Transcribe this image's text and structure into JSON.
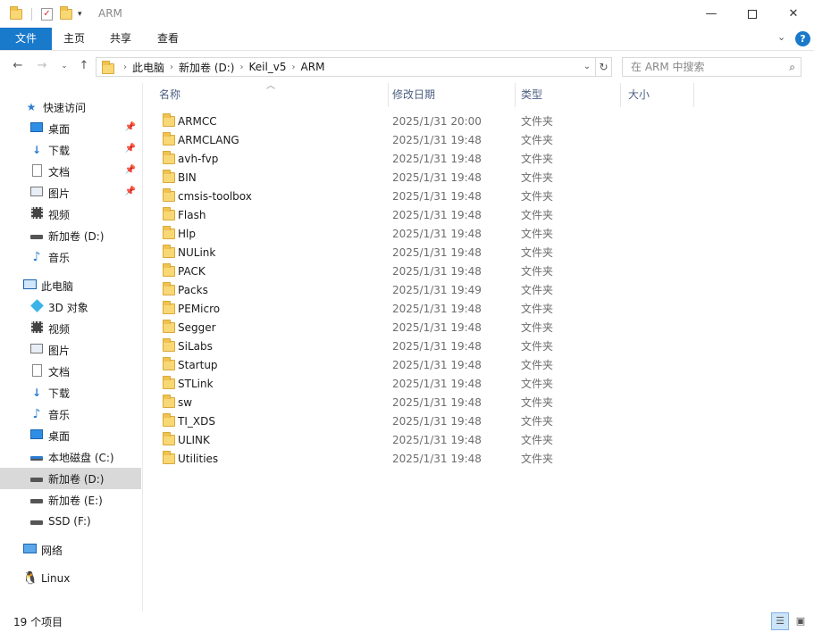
{
  "window": {
    "title": "ARM",
    "minimize_icon": "minimize-icon",
    "maximize_icon": "maximize-icon",
    "close_icon": "close-icon"
  },
  "ribbon": {
    "tabs": [
      "文件",
      "主页",
      "共享",
      "查看"
    ],
    "accent": "#1979ca"
  },
  "address": {
    "crumbs": [
      "此电脑",
      "新加卷 (D:)",
      "Keil_v5",
      "ARM"
    ],
    "search_placeholder": "在 ARM 中搜索"
  },
  "nav": {
    "quick_access": "快速访问",
    "quick_items": [
      "桌面",
      "下载",
      "文档",
      "图片",
      "视频",
      "新加卷 (D:)",
      "音乐"
    ],
    "this_pc": "此电脑",
    "pc_items": [
      "3D 对象",
      "视频",
      "图片",
      "文档",
      "下载",
      "音乐",
      "桌面",
      "本地磁盘 (C:)",
      "新加卷 (D:)",
      "新加卷 (E:)",
      "SSD (F:)"
    ],
    "network": "网络",
    "linux": "Linux"
  },
  "columns": {
    "name": "名称",
    "date": "修改日期",
    "type": "类型",
    "size": "大小"
  },
  "files": [
    {
      "name": "ARMCC",
      "date": "2025/1/31 20:00",
      "type": "文件夹"
    },
    {
      "name": "ARMCLANG",
      "date": "2025/1/31 19:48",
      "type": "文件夹"
    },
    {
      "name": "avh-fvp",
      "date": "2025/1/31 19:48",
      "type": "文件夹"
    },
    {
      "name": "BIN",
      "date": "2025/1/31 19:48",
      "type": "文件夹"
    },
    {
      "name": "cmsis-toolbox",
      "date": "2025/1/31 19:48",
      "type": "文件夹"
    },
    {
      "name": "Flash",
      "date": "2025/1/31 19:48",
      "type": "文件夹"
    },
    {
      "name": "Hlp",
      "date": "2025/1/31 19:48",
      "type": "文件夹"
    },
    {
      "name": "NULink",
      "date": "2025/1/31 19:48",
      "type": "文件夹"
    },
    {
      "name": "PACK",
      "date": "2025/1/31 19:48",
      "type": "文件夹"
    },
    {
      "name": "Packs",
      "date": "2025/1/31 19:49",
      "type": "文件夹"
    },
    {
      "name": "PEMicro",
      "date": "2025/1/31 19:48",
      "type": "文件夹"
    },
    {
      "name": "Segger",
      "date": "2025/1/31 19:48",
      "type": "文件夹"
    },
    {
      "name": "SiLabs",
      "date": "2025/1/31 19:48",
      "type": "文件夹"
    },
    {
      "name": "Startup",
      "date": "2025/1/31 19:48",
      "type": "文件夹"
    },
    {
      "name": "STLink",
      "date": "2025/1/31 19:48",
      "type": "文件夹"
    },
    {
      "name": "sw",
      "date": "2025/1/31 19:48",
      "type": "文件夹"
    },
    {
      "name": "TI_XDS",
      "date": "2025/1/31 19:48",
      "type": "文件夹"
    },
    {
      "name": "ULINK",
      "date": "2025/1/31 19:48",
      "type": "文件夹"
    },
    {
      "name": "Utilities",
      "date": "2025/1/31 19:48",
      "type": "文件夹"
    }
  ],
  "status": {
    "count": "19 个项目"
  }
}
